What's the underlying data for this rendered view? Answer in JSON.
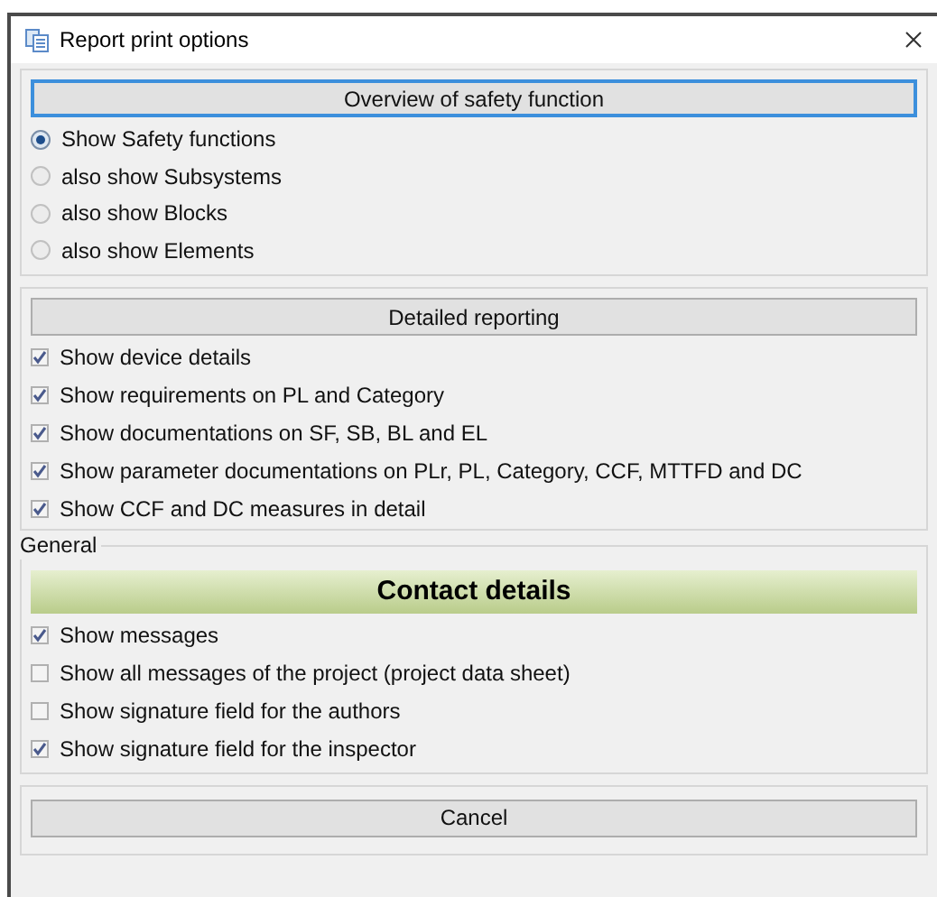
{
  "window": {
    "title": "Report print options"
  },
  "overview": {
    "heading": "Overview of safety function",
    "options": [
      {
        "label": "Show Safety functions",
        "selected": true
      },
      {
        "label": "also show Subsystems",
        "selected": false
      },
      {
        "label": "also show Blocks",
        "selected": false
      },
      {
        "label": "also show Elements",
        "selected": false
      }
    ]
  },
  "detailed": {
    "heading": "Detailed reporting",
    "options": [
      {
        "label": "Show device details",
        "checked": true
      },
      {
        "label": "Show requirements on PL and Category",
        "checked": true
      },
      {
        "label": "Show documentations on SF, SB, BL and EL",
        "checked": true
      },
      {
        "label": "Show parameter documentations on PLr, PL, Category, CCF, MTTFD and DC",
        "checked": true
      },
      {
        "label": "Show CCF and DC measures in detail",
        "checked": true
      }
    ]
  },
  "general": {
    "legend": "General",
    "heading": "Contact details",
    "options": [
      {
        "label": "Show messages",
        "checked": true
      },
      {
        "label": "Show all messages of the project (project data sheet)",
        "checked": false
      },
      {
        "label": "Show signature field for the authors",
        "checked": false
      },
      {
        "label": "Show signature field for the inspector",
        "checked": true
      }
    ]
  },
  "buttons": [
    "Cancel"
  ]
}
